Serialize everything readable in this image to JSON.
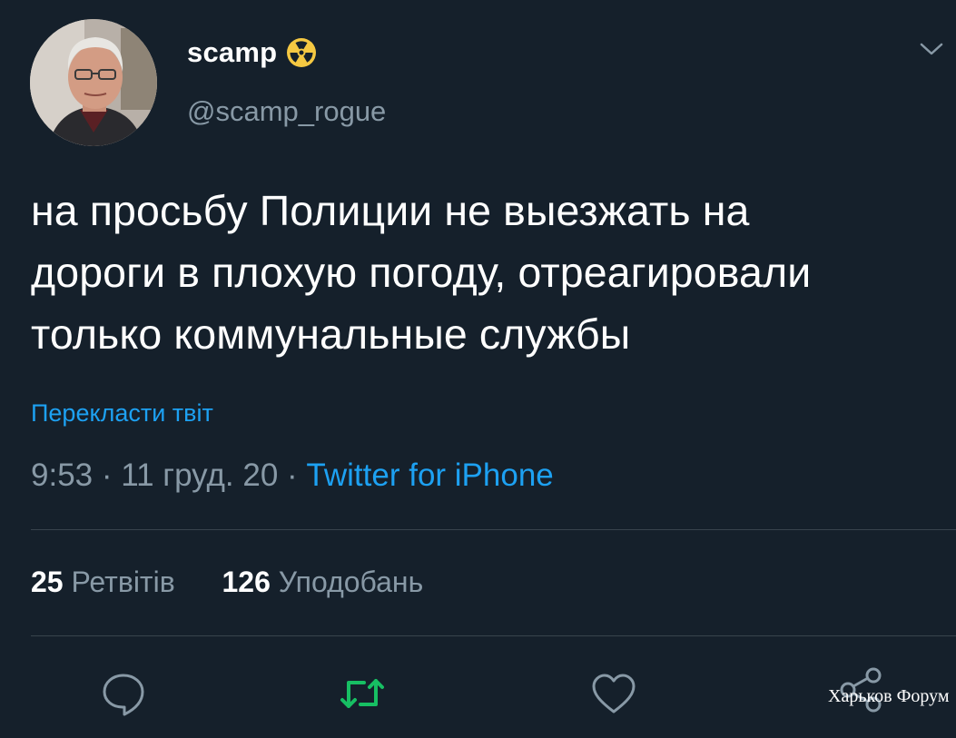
{
  "tweet": {
    "author": {
      "display_name": "scamp",
      "badge_icon": "radioactive-icon",
      "handle": "@scamp_rogue"
    },
    "text_lines": [
      "на просьбу Полиции не выезжать на",
      "дороги в плохую погоду, отреагировали",
      "только коммунальные службы"
    ],
    "translate_label": "Перекласти твіт",
    "time": "9:53",
    "separator": "·",
    "date": "11 груд. 20",
    "source": "Twitter for iPhone",
    "stats": {
      "retweets_count": "25",
      "retweets_label": "Ретвітів",
      "likes_count": "126",
      "likes_label": "Уподобань"
    },
    "actions": [
      {
        "name": "reply",
        "icon": "reply-icon"
      },
      {
        "name": "retweet",
        "icon": "retweet-icon"
      },
      {
        "name": "like",
        "icon": "heart-icon"
      },
      {
        "name": "share",
        "icon": "share-icon"
      }
    ]
  },
  "watermark": "Харьков Форум",
  "colors": {
    "background": "#15202b",
    "text_primary": "#ffffff",
    "text_secondary": "#8899a6",
    "link": "#1da1f2",
    "retweet_active": "#17bf63",
    "divider": "#38444d",
    "badge": "#f5c842"
  }
}
